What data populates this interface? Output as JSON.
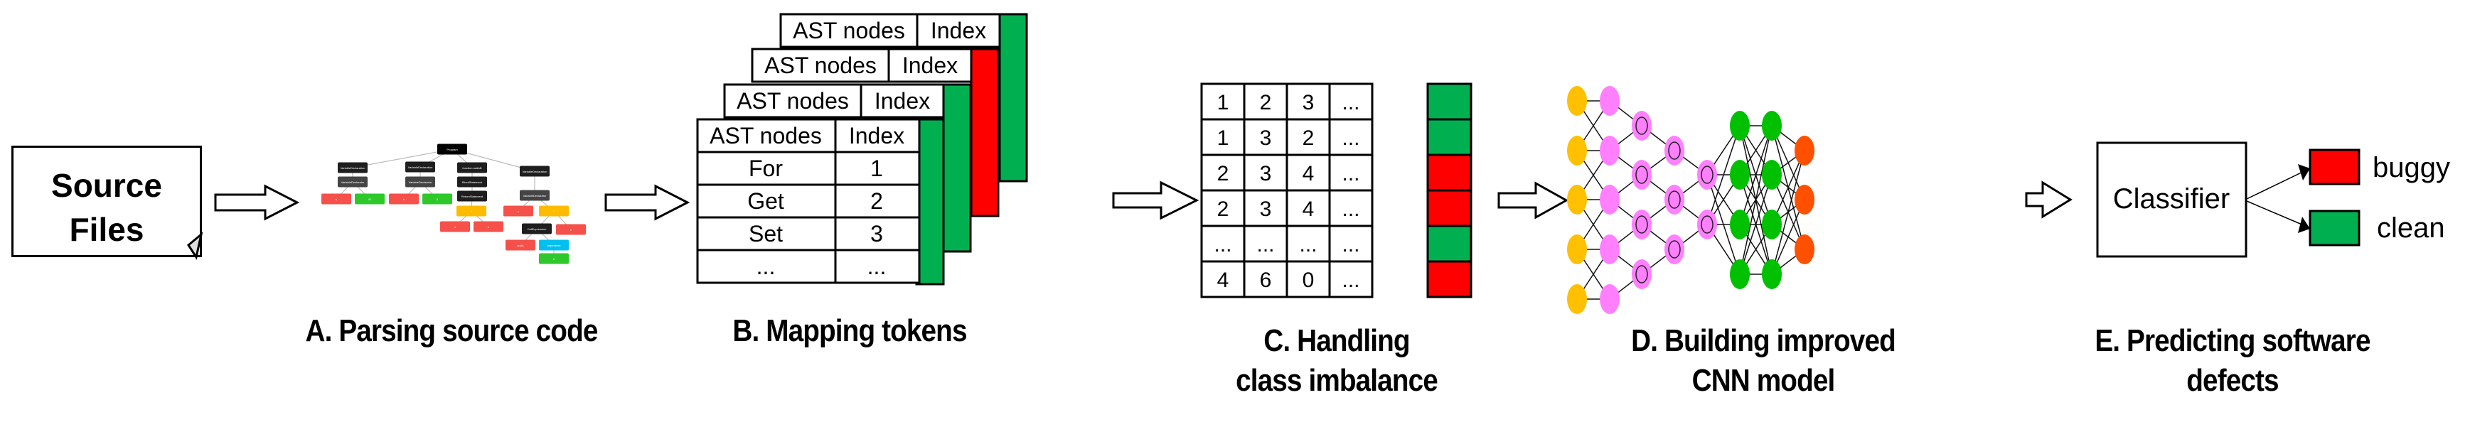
{
  "source": {
    "label_line1": "Source",
    "label_line2": "Files"
  },
  "captions": {
    "a": "A. Parsing source code",
    "b": "B. Mapping tokens",
    "c_line1": "C.  Handling",
    "c_line2": "class imbalance",
    "d_line1": "D.  Building improved",
    "d_line2": "CNN model",
    "e_line1": "E.  Predicting software",
    "e_line2": "defects"
  },
  "ast_tree": {
    "nodes": [
      {
        "label": "Program",
        "type": "root"
      },
      {
        "label": "VariableDeclaration",
        "type": "dark"
      },
      {
        "label": "VariableDeclarator",
        "type": "gray"
      },
      {
        "label": "a",
        "type": "red"
      },
      {
        "label": "42",
        "type": "green"
      },
      {
        "label": "VariableDeclaration",
        "type": "dark"
      },
      {
        "label": "VariableDeclarator",
        "type": "gray"
      },
      {
        "label": "b",
        "type": "red"
      },
      {
        "label": "8",
        "type": "green"
      },
      {
        "label": "function addAB",
        "type": "dark"
      },
      {
        "label": "BlockStatement",
        "type": "dark"
      },
      {
        "label": "ReturnStatement",
        "type": "dark"
      },
      {
        "label": "+",
        "type": "yellow"
      },
      {
        "label": "a",
        "type": "red"
      },
      {
        "label": "b",
        "type": "red"
      },
      {
        "label": "VariableDeclaration",
        "type": "dark"
      },
      {
        "label": "VariableDeclarator",
        "type": "gray"
      },
      {
        "label": "c",
        "type": "red"
      },
      {
        "label": "+",
        "type": "yellow"
      },
      {
        "label": "CallExpression",
        "type": "dark"
      },
      {
        "label": "b",
        "type": "red"
      },
      {
        "label": "addA",
        "type": "red"
      },
      {
        "label": "arguments",
        "type": "blue"
      },
      {
        "label": "2",
        "type": "green"
      }
    ]
  },
  "token_tables": {
    "header": [
      "AST nodes",
      "Index"
    ],
    "stack_colors": [
      "green",
      "red",
      "green",
      "green"
    ],
    "rows": [
      [
        "For",
        "1"
      ],
      [
        "Get",
        "2"
      ],
      [
        "Set",
        "3"
      ],
      [
        "...",
        "..."
      ]
    ]
  },
  "balance_matrix": {
    "rows": [
      {
        "cells": [
          "1",
          "2",
          "3",
          "..."
        ],
        "label": "clean"
      },
      {
        "cells": [
          "1",
          "3",
          "2",
          "..."
        ],
        "label": "clean"
      },
      {
        "cells": [
          "2",
          "3",
          "4",
          "..."
        ],
        "label": "buggy"
      },
      {
        "cells": [
          "2",
          "3",
          "4",
          "..."
        ],
        "label": "buggy"
      },
      {
        "cells": [
          "...",
          "...",
          "...",
          "..."
        ],
        "label": "clean"
      },
      {
        "cells": [
          "4",
          "6",
          "0",
          "..."
        ],
        "label": "buggy"
      }
    ]
  },
  "cnn": {
    "layers": [
      {
        "count": 5,
        "color": "yellow",
        "ring": false
      },
      {
        "count": 5,
        "color": "pink",
        "ring": false
      },
      {
        "count": 4,
        "color": "pink",
        "ring": true
      },
      {
        "count": 3,
        "color": "pink",
        "ring": true
      },
      {
        "count": 2,
        "color": "pink",
        "ring": true
      },
      {
        "count": 4,
        "color": "green",
        "ring": false
      },
      {
        "count": 4,
        "color": "green",
        "ring": false
      },
      {
        "count": 3,
        "color": "orange",
        "ring": false
      }
    ]
  },
  "classifier": {
    "label": "Classifier",
    "outputs": [
      {
        "label": "buggy",
        "color": "red"
      },
      {
        "label": "clean",
        "color": "green"
      }
    ]
  },
  "colors": {
    "red": "#ff0000",
    "green": "#00b050",
    "ast_red": "#f5504a",
    "ast_green": "#2ec82a",
    "ast_yellow": "#ffbb00",
    "ast_blue": "#00c0f0",
    "ast_dark": "#1e1e1e",
    "ast_gray": "#444444",
    "cnn_yellow": "#ffc000",
    "cnn_pink": "#ff80ff",
    "cnn_green": "#00c000",
    "cnn_orange": "#ff5000"
  }
}
